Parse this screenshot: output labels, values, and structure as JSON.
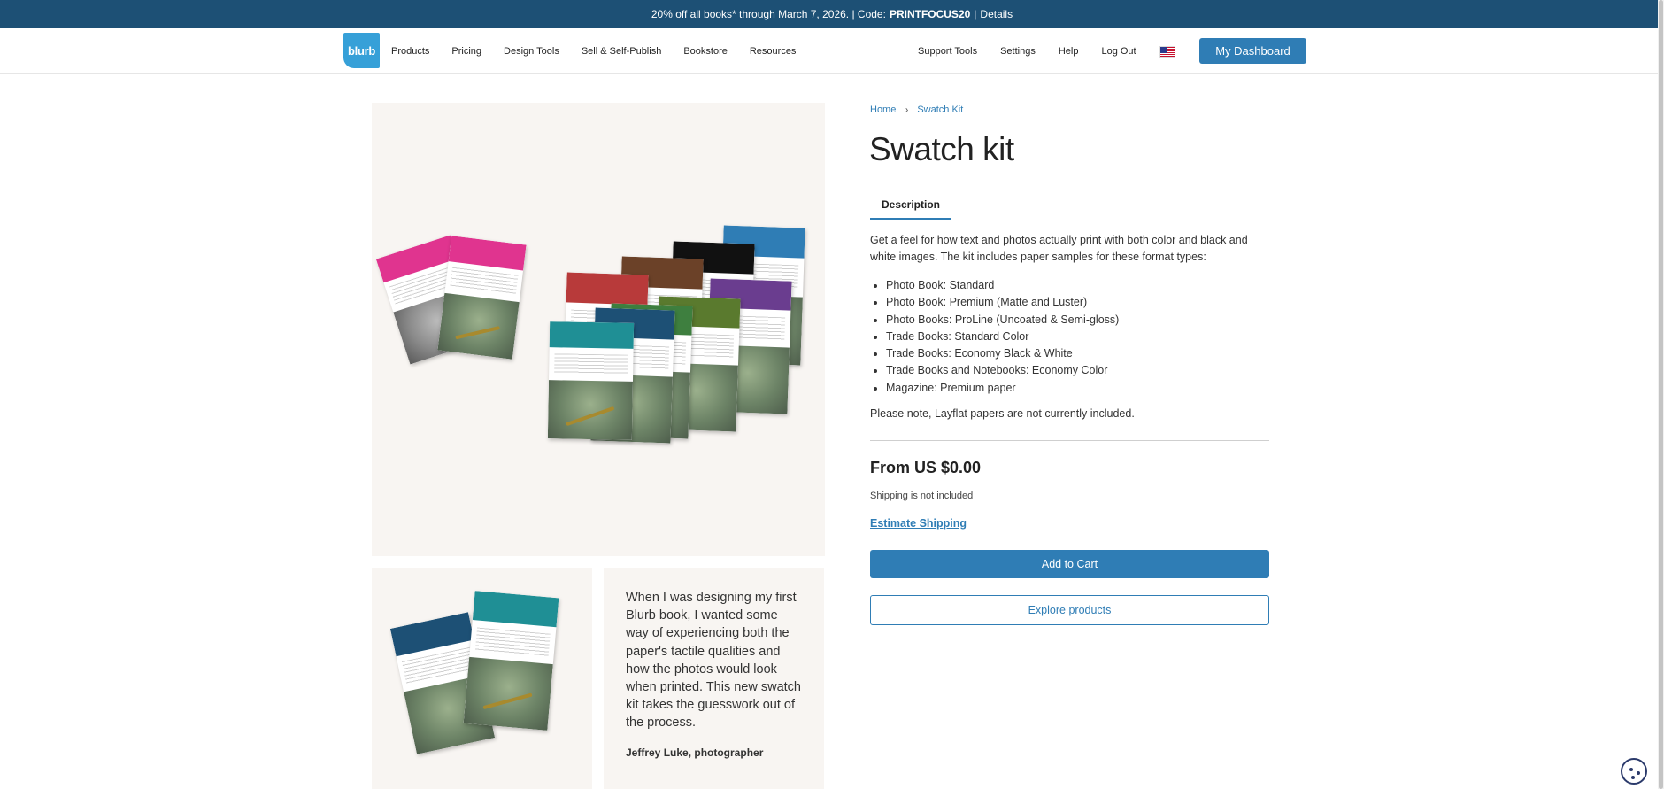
{
  "promo": {
    "text": "20% off all books* through March 7, 2026. | Code: ",
    "code": "PRINTFOCUS20",
    "sep": " | ",
    "details": "Details"
  },
  "header": {
    "logo": "blurb",
    "nav_left": [
      "Products",
      "Pricing",
      "Design Tools",
      "Sell & Self-Publish",
      "Bookstore",
      "Resources"
    ],
    "nav_right": [
      "Support Tools",
      "Settings",
      "Help",
      "Log Out"
    ],
    "flag_icon": "us-flag-icon",
    "dashboard_button": "My Dashboard"
  },
  "breadcrumb": {
    "home": "Home",
    "current": "Swatch Kit"
  },
  "product": {
    "title": "Swatch kit",
    "tab": "Description",
    "description": "Get a feel for how text and photos actually print with both color and black and white images. The kit includes paper samples for these format types:",
    "features": [
      "Photo Book: Standard",
      "Photo Book: Premium (Matte and Luster)",
      "Photo Books: ProLine (Uncoated & Semi-gloss)",
      "Trade Books: Standard Color",
      "Trade Books: Economy Black & White",
      "Trade Books and Notebooks: Economy Color",
      "Magazine: Premium paper"
    ],
    "note": "Please note, Layflat papers are not currently included.",
    "price": "From US $0.00",
    "shipping_note": "Shipping is not included",
    "estimate_link": "Estimate Shipping",
    "add_to_cart": "Add to Cart",
    "explore": "Explore products"
  },
  "testimonial": {
    "quote": "When I was designing my first Blurb book, I wanted some way of experiencing both the paper's tactile qualities and how the photos would look when printed. This new swatch kit takes the guesswork out of the process.",
    "author": "Jeffrey Luke, photographer"
  },
  "colors": {
    "banner": "#1d5075",
    "accent": "#2f7db5",
    "logo": "#36a0d8",
    "image_bg": "#f8f5f2"
  }
}
